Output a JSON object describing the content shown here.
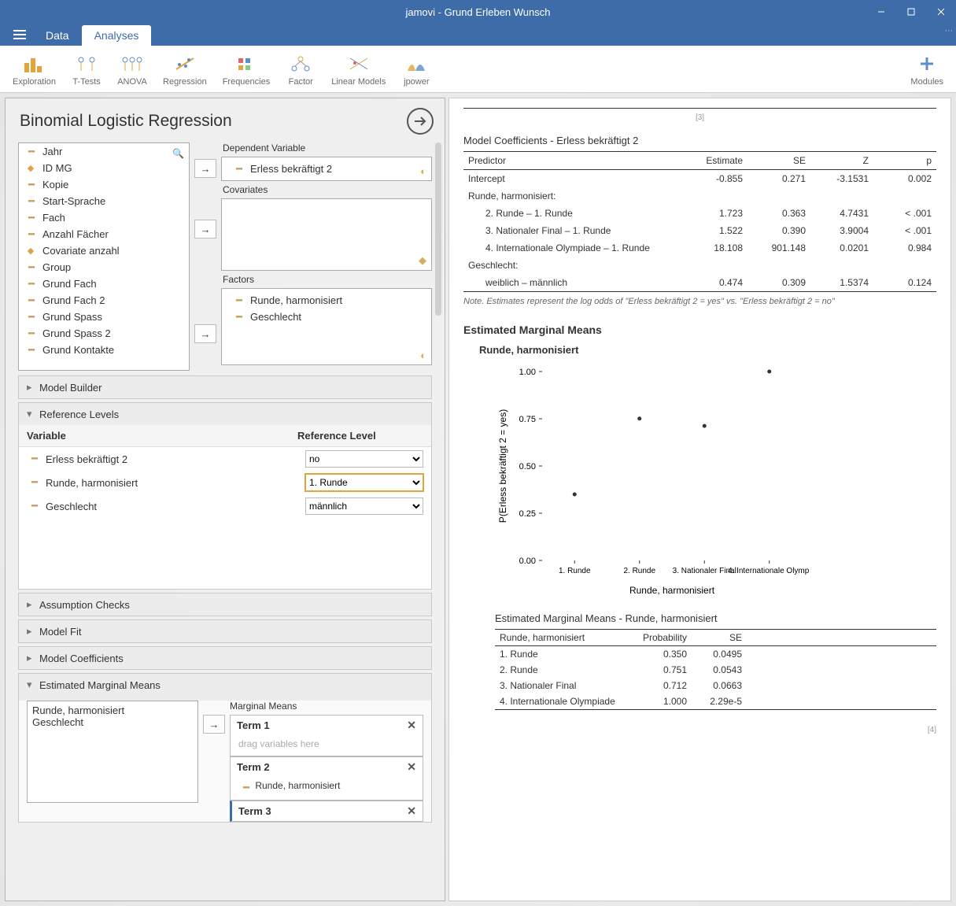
{
  "titlebar": {
    "title": "jamovi - Grund Erleben Wunsch"
  },
  "tabs": {
    "data": "Data",
    "analyses": "Analyses"
  },
  "ribbon": {
    "exploration": "Exploration",
    "ttests": "T-Tests",
    "anova": "ANOVA",
    "regression": "Regression",
    "frequencies": "Frequencies",
    "factor": "Factor",
    "linear_models": "Linear Models",
    "jpower": "jpower",
    "modules": "Modules"
  },
  "panel": {
    "title": "Binomial Logistic Regression",
    "vars": [
      "Jahr",
      "ID MG",
      "Kopie",
      "Start-Sprache",
      "Fach",
      "Anzahl Fächer",
      "Covariate anzahl",
      "Group",
      "Grund Fach",
      "Grund Fach 2",
      "Grund Spass",
      "Grund Spass 2",
      "Grund Kontakte"
    ],
    "var_types": [
      "nom",
      "id",
      "nom",
      "nom",
      "nom",
      "nom",
      "id",
      "nom",
      "nom",
      "nom",
      "nom",
      "nom",
      "nom"
    ],
    "targets": {
      "dep_label": "Dependent Variable",
      "dep_value": "Erless bekräftigt 2",
      "cov_label": "Covariates",
      "fac_label": "Factors",
      "fac_values": [
        "Runde, harmonisiert",
        "Geschlecht"
      ]
    },
    "sections": {
      "model_builder": "Model Builder",
      "reference_levels": "Reference Levels",
      "assumption_checks": "Assumption Checks",
      "model_fit": "Model Fit",
      "model_coef": "Model Coefficients",
      "emm": "Estimated Marginal Means"
    },
    "ref": {
      "hdr_var": "Variable",
      "hdr_level": "Reference Level",
      "rows": [
        {
          "var": "Erless bekräftigt 2",
          "level": "no"
        },
        {
          "var": "Runde, harmonisiert",
          "level": "1. Runde"
        },
        {
          "var": "Geschlecht",
          "level": "männlich"
        }
      ]
    },
    "emm_block": {
      "supply": [
        "Runde, harmonisiert",
        "Geschlecht"
      ],
      "label": "Marginal Means",
      "terms": [
        {
          "title": "Term 1",
          "placeholder": "drag variables here",
          "vars": []
        },
        {
          "title": "Term 2",
          "vars": [
            "Runde, harmonisiert"
          ]
        },
        {
          "title": "Term 3",
          "vars": []
        }
      ]
    }
  },
  "results": {
    "pagenum_top": "[3]",
    "coef_title": "Model Coefficients - Erless bekräftigt 2",
    "coef_headers": [
      "Predictor",
      "Estimate",
      "SE",
      "Z",
      "p"
    ],
    "coef_rows": [
      {
        "pred": "Intercept",
        "est": "-0.855",
        "se": "0.271",
        "z": "-3.1531",
        "p": "0.002",
        "indent": false
      },
      {
        "pred": "Runde, harmonisiert:",
        "est": "",
        "se": "",
        "z": "",
        "p": "",
        "indent": false
      },
      {
        "pred": "2. Runde – 1. Runde",
        "est": "1.723",
        "se": "0.363",
        "z": "4.7431",
        "p": "< .001",
        "indent": true
      },
      {
        "pred": "3. Nationaler Final – 1. Runde",
        "est": "1.522",
        "se": "0.390",
        "z": "3.9004",
        "p": "< .001",
        "indent": true
      },
      {
        "pred": "4. Internationale Olympiade – 1. Runde",
        "est": "18.108",
        "se": "901.148",
        "z": "0.0201",
        "p": "0.984",
        "indent": true
      },
      {
        "pred": "Geschlecht:",
        "est": "",
        "se": "",
        "z": "",
        "p": "",
        "indent": false
      },
      {
        "pred": "weiblich – männlich",
        "est": "0.474",
        "se": "0.309",
        "z": "1.5374",
        "p": "0.124",
        "indent": true
      }
    ],
    "coef_note": "Note. Estimates represent the log odds of \"Erless bekräftigt 2 = yes\" vs. \"Erless bekräftigt 2 = no\"",
    "emm_heading": "Estimated Marginal Means",
    "emm_sub": "Runde, harmonisiert",
    "emm_table_title": "Estimated Marginal Means - Runde, harmonisiert",
    "emm_headers": [
      "Runde, harmonisiert",
      "Probability",
      "SE"
    ],
    "emm_rows": [
      {
        "cat": "1. Runde",
        "p": "0.350",
        "se": "0.0495"
      },
      {
        "cat": "2. Runde",
        "p": "0.751",
        "se": "0.0543"
      },
      {
        "cat": "3. Nationaler Final",
        "p": "0.712",
        "se": "0.0663"
      },
      {
        "cat": "4. Internationale Olympiade",
        "p": "1.000",
        "se": "2.29e-5"
      }
    ],
    "pagenum_bottom": "[4]"
  },
  "chart_data": {
    "type": "scatter",
    "title": "",
    "xlabel": "Runde, harmonisiert",
    "ylabel": "P(Erless bekräftigt 2 = yes)",
    "categories": [
      "1. Runde",
      "2. Runde",
      "3. Nationaler Final",
      "4. Internationale Olympiade"
    ],
    "x_tick_labels": [
      "1. Runde",
      "2. Runde",
      "3. Nationaler Final",
      "4. Internationale Olympi"
    ],
    "values": [
      0.35,
      0.751,
      0.712,
      1.0
    ],
    "ylim": [
      0,
      1
    ],
    "yticks": [
      0.0,
      0.25,
      0.5,
      0.75,
      1.0
    ]
  }
}
